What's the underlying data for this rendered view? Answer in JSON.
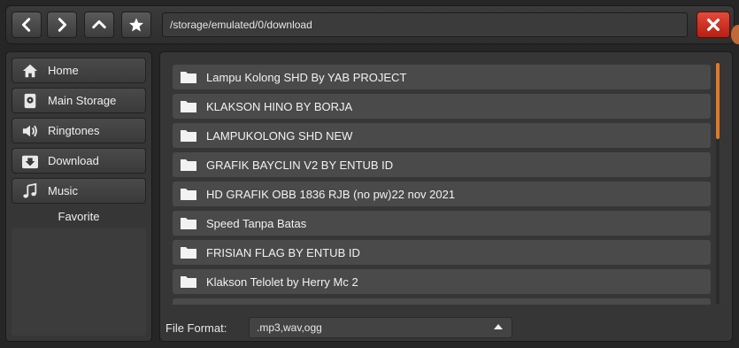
{
  "toolbar": {
    "back_icon": "chevron-left-icon",
    "forward_icon": "chevron-right-icon",
    "up_icon": "chevron-up-icon",
    "favorite_icon": "star-icon",
    "path": "/storage/emulated/0/download",
    "close_icon": "close-icon",
    "close_color": "#d42a1d"
  },
  "sidebar": {
    "items": [
      {
        "label": "Home",
        "icon": "home-icon"
      },
      {
        "label": "Main Storage",
        "icon": "storage-icon"
      },
      {
        "label": "Ringtones",
        "icon": "speaker-icon"
      },
      {
        "label": "Download",
        "icon": "download-icon"
      },
      {
        "label": "Music",
        "icon": "music-note-icon"
      }
    ],
    "favorite_label": "Favorite"
  },
  "files": [
    {
      "name": "Lampu Kolong SHD By YAB PROJECT"
    },
    {
      "name": "KLAKSON HINO BY BORJA"
    },
    {
      "name": "LAMPUKOLONG SHD NEW"
    },
    {
      "name": "GRAFIK BAYCLIN V2 BY ENTUB ID"
    },
    {
      "name": "HD GRAFIK OBB 1836 RJB (no pw)22 nov 2021"
    },
    {
      "name": "Speed Tanpa Batas"
    },
    {
      "name": "FRISIAN FLAG BY ENTUB ID"
    },
    {
      "name": "Klakson Telolet by Herry Mc 2"
    },
    {
      "name": ""
    }
  ],
  "file_format": {
    "label": "File Format:",
    "value": ".mp3,wav,ogg"
  },
  "colors": {
    "accent_scroll": "#e07a2a",
    "background": "#262626"
  }
}
